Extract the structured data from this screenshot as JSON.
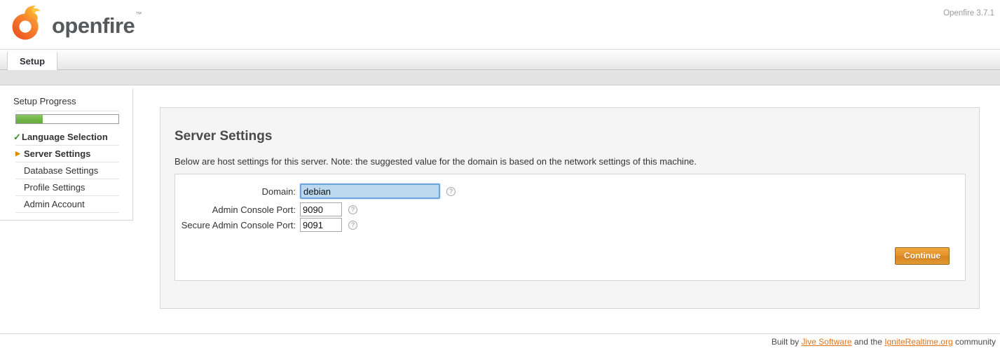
{
  "header": {
    "product_name": "openfire",
    "trademark": "™",
    "version": "Openfire 3.7.1",
    "logo_icon": "openfire-flame-logo"
  },
  "tabs": [
    {
      "label": "Setup",
      "active": true
    }
  ],
  "sidebar": {
    "title": "Setup Progress",
    "progress_percent": 26,
    "items": [
      {
        "label": "Language Selection",
        "state": "done",
        "marker": "✓"
      },
      {
        "label": "Server Settings",
        "state": "current",
        "marker": "▶"
      },
      {
        "label": "Database Settings",
        "state": "pending",
        "marker": ""
      },
      {
        "label": "Profile Settings",
        "state": "pending",
        "marker": ""
      },
      {
        "label": "Admin Account",
        "state": "pending",
        "marker": ""
      }
    ]
  },
  "main": {
    "title": "Server Settings",
    "description": "Below are host settings for this server. Note: the suggested value for the domain is based on the network settings of this machine.",
    "fields": [
      {
        "label": "Domain:",
        "value": "debian",
        "placeholder": "",
        "help": "?",
        "focused": true
      },
      {
        "label": "Admin Console Port:",
        "value": "9090",
        "placeholder": "",
        "help": "?",
        "focused": false
      },
      {
        "label": "Secure Admin Console Port:",
        "value": "9091",
        "placeholder": "",
        "help": "?",
        "focused": false
      }
    ],
    "continue_label": "Continue"
  },
  "footer": {
    "prefix": "Built by ",
    "link1": "Jive Software",
    "middle": " and the ",
    "link2": "IgniteRealtime.org",
    "suffix": " community"
  },
  "colors": {
    "accent_orange": "#e5731a",
    "progress_green": "#6fb546",
    "focus_blue": "#6aa6dd",
    "selection_blue": "#bcd7f0",
    "button_orange": "#e2912a"
  }
}
